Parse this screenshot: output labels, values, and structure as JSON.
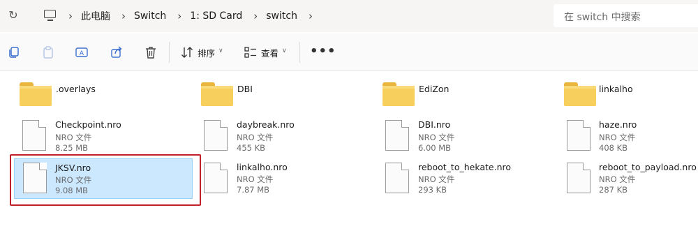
{
  "address_bar": {
    "breadcrumb": [
      "此电脑",
      "Switch",
      "1: SD Card",
      "switch"
    ],
    "search_placeholder": "在 switch 中搜索"
  },
  "toolbar": {
    "sort_label": "排序",
    "view_label": "查看",
    "more_label": "•••",
    "icons": [
      "copy-icon",
      "paste-icon",
      "rename-icon",
      "share-icon",
      "delete-icon",
      "sort-icon",
      "view-icon"
    ]
  },
  "folders": [
    {
      "name": ".overlays"
    },
    {
      "name": "DBI"
    },
    {
      "name": "EdiZon"
    },
    {
      "name": "linkalho"
    }
  ],
  "files": [
    {
      "name": "Checkpoint.nro",
      "type": "NRO 文件",
      "size": "8.25 MB",
      "selected": false
    },
    {
      "name": "daybreak.nro",
      "type": "NRO 文件",
      "size": "455 KB",
      "selected": false
    },
    {
      "name": "DBI.nro",
      "type": "NRO 文件",
      "size": "6.00 MB",
      "selected": false
    },
    {
      "name": "haze.nro",
      "type": "NRO 文件",
      "size": "408 KB",
      "selected": false
    },
    {
      "name": "JKSV.nro",
      "type": "NRO 文件",
      "size": "9.08 MB",
      "selected": true
    },
    {
      "name": "linkalho.nro",
      "type": "NRO 文件",
      "size": "7.87 MB",
      "selected": false
    },
    {
      "name": "reboot_to_hekate.nro",
      "type": "NRO 文件",
      "size": "293 KB",
      "selected": false
    },
    {
      "name": "reboot_to_payload.nro",
      "type": "NRO 文件",
      "size": "287 KB",
      "selected": false
    }
  ],
  "colors": {
    "selection_fill": "#cce8ff",
    "highlight_frame": "#c0202a",
    "folder": "#f7cf5c"
  }
}
